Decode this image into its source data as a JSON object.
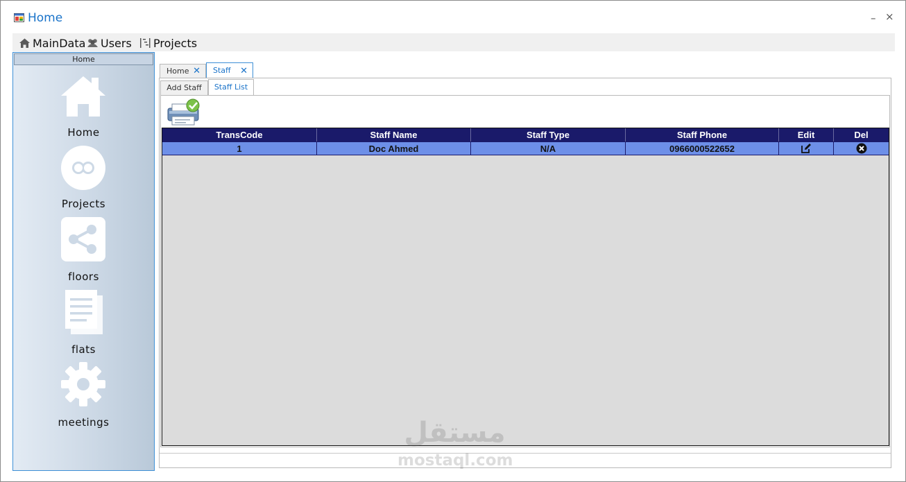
{
  "window": {
    "title": "Home",
    "minimize_glyph": "–",
    "close_glyph": "×"
  },
  "menu": {
    "items": [
      {
        "label": "MainData",
        "icon": "home-icon"
      },
      {
        "label": "Users",
        "icon": "users-icon"
      },
      {
        "label": "Projects",
        "icon": "projects-icon"
      }
    ]
  },
  "sidebar": {
    "header": "Home",
    "items": [
      {
        "label": "Home",
        "icon": "house-icon"
      },
      {
        "label": "Projects",
        "icon": "circles-icon"
      },
      {
        "label": "floors",
        "icon": "share-icon"
      },
      {
        "label": "flats",
        "icon": "documents-icon"
      },
      {
        "label": "meetings",
        "icon": "gear-icon"
      }
    ]
  },
  "tabs": [
    {
      "label": "Home",
      "close": "✕",
      "active": false
    },
    {
      "label": "Staff",
      "close": "✕",
      "active": true
    }
  ],
  "subtabs": [
    {
      "label": "Add Staff",
      "active": false
    },
    {
      "label": "Staff List",
      "active": true
    }
  ],
  "grid": {
    "columns": [
      "TransCode",
      "Staff Name",
      "Staff Type",
      "Staff Phone",
      "Edit",
      "Del"
    ],
    "rows": [
      {
        "trans_code": "1",
        "staff_name": "Doc Ahmed",
        "staff_type": "N/A",
        "staff_phone": "0966000522652",
        "edit_icon": "edit-icon",
        "del_icon": "delete-icon"
      }
    ]
  },
  "watermark": {
    "arabic": "مستقل",
    "latin": "mostaql.com"
  },
  "colors": {
    "accent": "#1a73c9",
    "grid_header": "#1a1a6a",
    "grid_row": "#6d8fe8",
    "grid_bg": "#dcdcdc"
  }
}
